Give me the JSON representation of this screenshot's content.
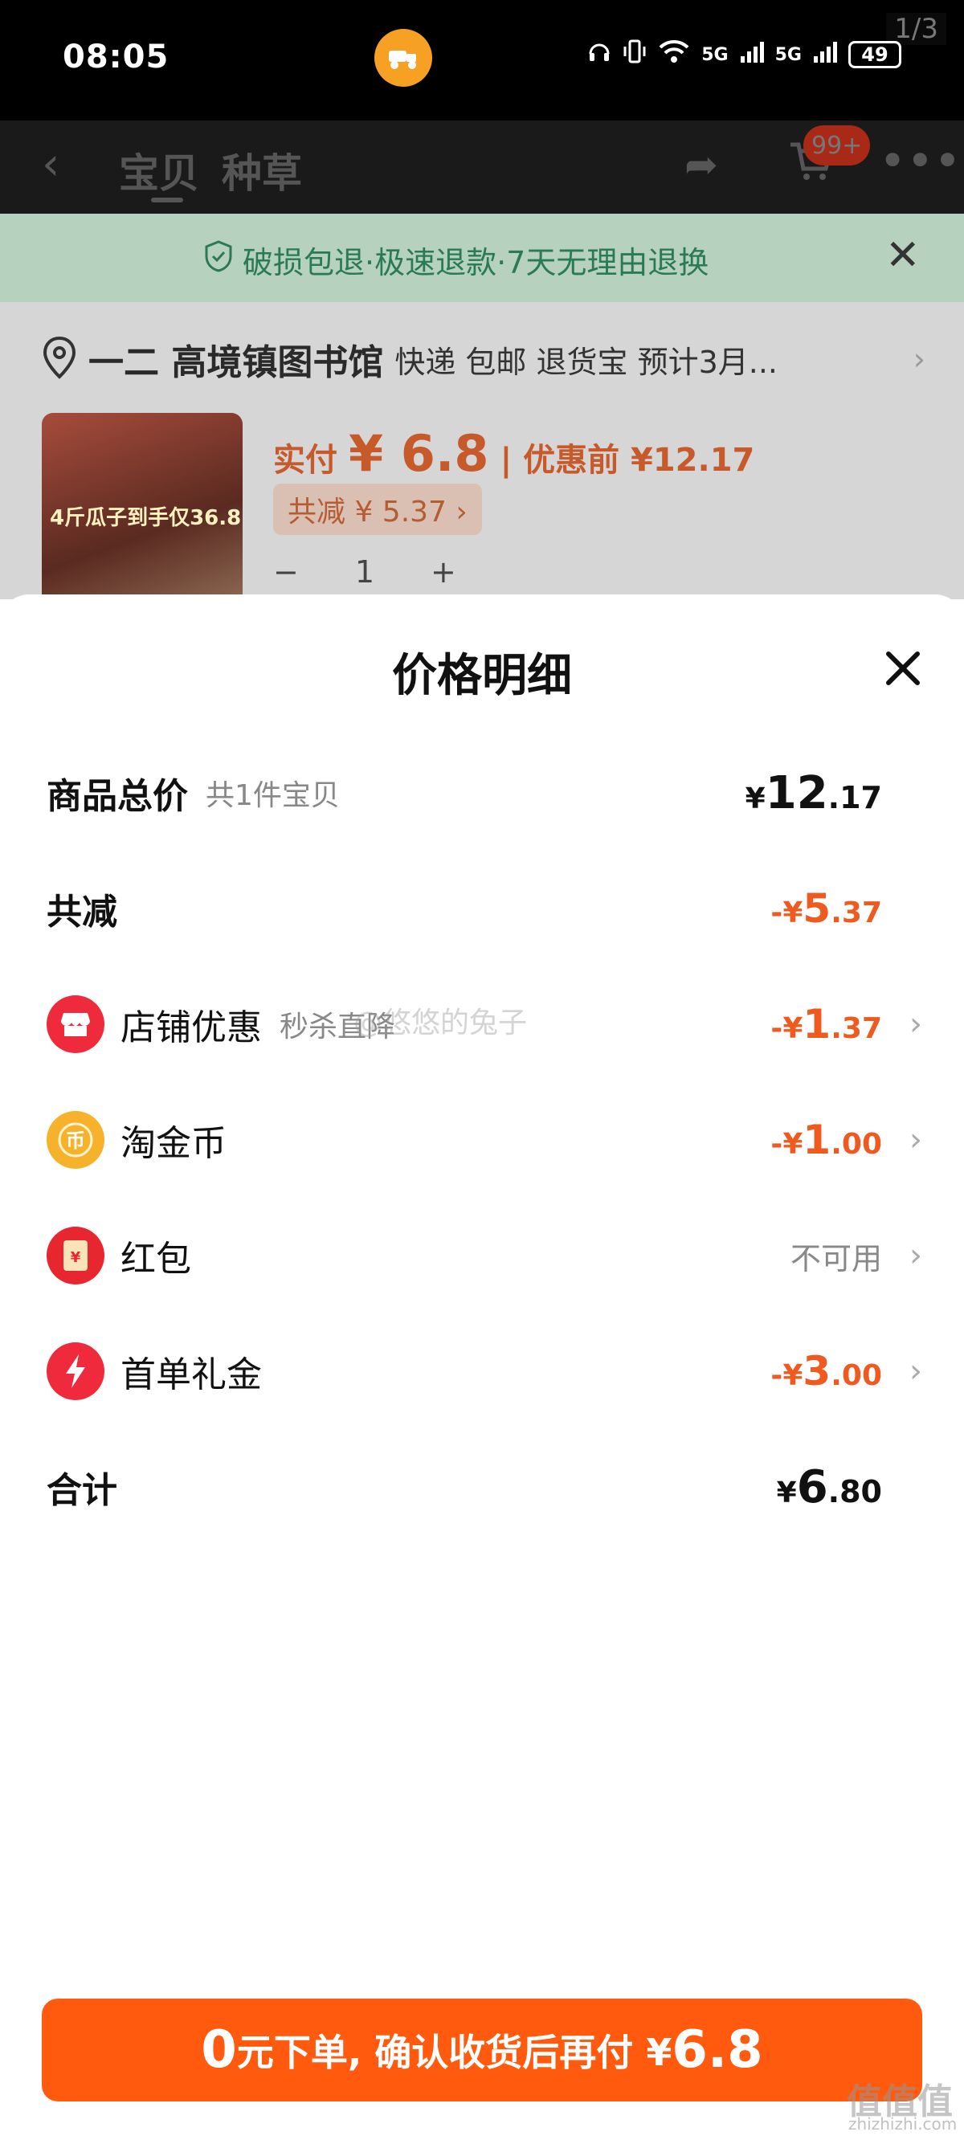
{
  "status_bar": {
    "time": "08:05",
    "signal_1": "5G",
    "signal_2": "5G",
    "battery": "49",
    "pager": "1/3"
  },
  "nav": {
    "tab_active": "宝贝",
    "tab_other": "种草",
    "cart_badge": "99+"
  },
  "background": {
    "guarantee": "破损包退·极速退款·7天无理由退换",
    "address_name": "一二 高境镇图书馆",
    "address_info": "快递 包邮 退货宝 预计3月...",
    "product_image_text": "4斤瓜子到手仅36.8",
    "price_label": "实付",
    "price_value": "¥ 6.8",
    "price_before": "| 优惠前 ¥12.17",
    "reduce_chip": "共减 ¥ 5.37 ›",
    "qty_minus": "−",
    "qty_value": "1",
    "qty_plus": "+"
  },
  "sheet": {
    "title": "价格明细",
    "rows": {
      "total": {
        "label": "商品总价",
        "sub": "共1件宝贝",
        "sym": "¥",
        "int": "12",
        "dec": ".17"
      },
      "reduce": {
        "label": "共减",
        "sym": "-¥",
        "int": "5",
        "dec": ".37"
      },
      "shop": {
        "label": "店铺优惠",
        "sub": "秒杀直降",
        "sym": "-¥",
        "int": "1",
        "dec": ".37"
      },
      "coin": {
        "label": "淘金币",
        "sym": "-¥",
        "int": "1",
        "dec": ".00"
      },
      "redpack": {
        "label": "红包",
        "value": "不可用"
      },
      "first": {
        "label": "首单礼金",
        "sym": "-¥",
        "int": "3",
        "dec": ".00"
      },
      "sum": {
        "label": "合计",
        "sym": "¥",
        "int": "6",
        "dec": ".80"
      }
    },
    "watermark": "@悠悠的兔子"
  },
  "cta": {
    "prefix": "0",
    "text": "元下单, 确认收货后再付 ¥",
    "amount": "6.8"
  },
  "brand": {
    "mark": "值值值",
    "sub": "zhizhizhi.com"
  },
  "colors": {
    "accent": "#ff5a0e",
    "discount": "#ee5a1f",
    "guarantee_green": "#2a7a54"
  }
}
